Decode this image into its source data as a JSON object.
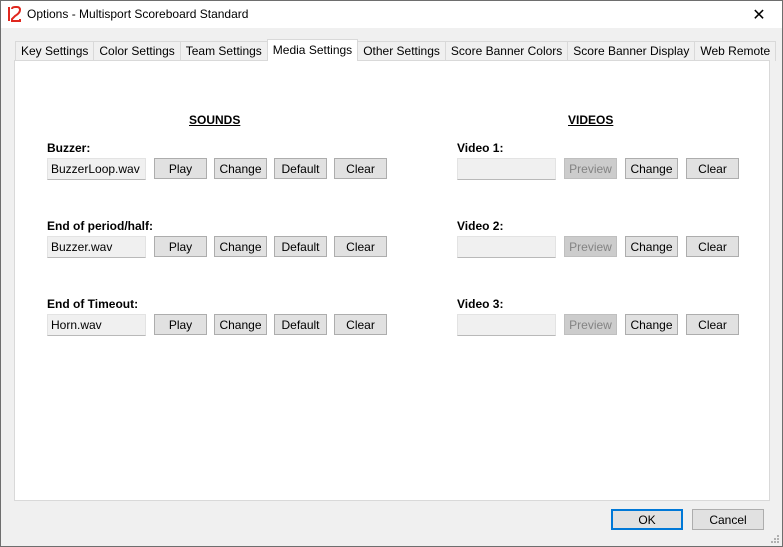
{
  "window": {
    "title": "Options - Multisport Scoreboard Standard"
  },
  "tabs": [
    {
      "label": "Key Settings"
    },
    {
      "label": "Color Settings"
    },
    {
      "label": "Team Settings"
    },
    {
      "label": "Media Settings",
      "active": true
    },
    {
      "label": "Other Settings"
    },
    {
      "label": "Score Banner Colors"
    },
    {
      "label": "Score Banner Display"
    },
    {
      "label": "Web Remote"
    }
  ],
  "sounds": {
    "header": "SOUNDS",
    "items": [
      {
        "label": "Buzzer:",
        "file": "BuzzerLoop.wav",
        "play": "Play",
        "change": "Change",
        "default": "Default",
        "clear": "Clear"
      },
      {
        "label": "End of period/half:",
        "file": "Buzzer.wav",
        "play": "Play",
        "change": "Change",
        "default": "Default",
        "clear": "Clear"
      },
      {
        "label": "End of Timeout:",
        "file": "Horn.wav",
        "play": "Play",
        "change": "Change",
        "default": "Default",
        "clear": "Clear"
      }
    ]
  },
  "videos": {
    "header": "VIDEOS",
    "items": [
      {
        "label": "Video 1:",
        "file": "",
        "preview": "Preview",
        "change": "Change",
        "clear": "Clear"
      },
      {
        "label": "Video 2:",
        "file": "",
        "preview": "Preview",
        "change": "Change",
        "clear": "Clear"
      },
      {
        "label": "Video 3:",
        "file": "",
        "preview": "Preview",
        "change": "Change",
        "clear": "Clear"
      }
    ]
  },
  "footer": {
    "ok": "OK",
    "cancel": "Cancel"
  }
}
